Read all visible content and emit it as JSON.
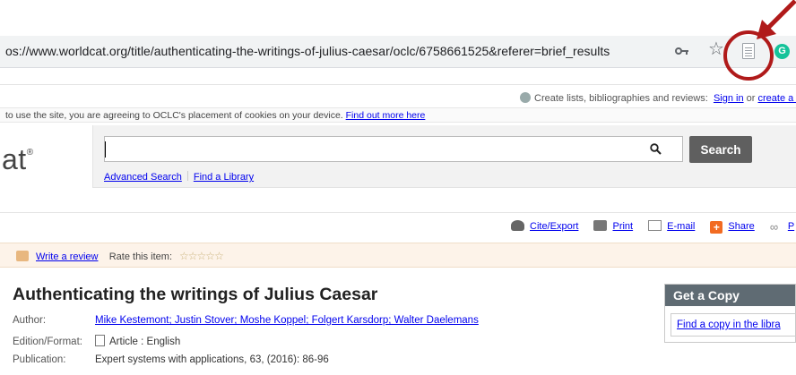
{
  "browser": {
    "url": "os://www.worldcat.org/title/authenticating-the-writings-of-julius-caesar/oclc/6758661525&referer=brief_results"
  },
  "header": {
    "create_lists_text": "Create lists, bibliographies and reviews:",
    "sign_in": "Sign in",
    "or": "or",
    "create_account": "create a f",
    "cookie_notice": "to use the site, you are agreeing to OCLC's placement of cookies on your device.",
    "cookie_link": "Find out more here"
  },
  "logo": {
    "text": "at",
    "mark": "®"
  },
  "search": {
    "value": "",
    "button_label": "Search",
    "advanced_link": "Advanced Search",
    "find_library_link": "Find a Library"
  },
  "toolbar": {
    "cite_export": "Cite/Export",
    "print": "Print",
    "email": "E-mail",
    "share": "Share",
    "permalink": "P"
  },
  "review": {
    "write_review": "Write a review",
    "rate_label": "Rate this item:",
    "stars": "☆☆☆☆☆"
  },
  "record": {
    "title": "Authenticating the writings of Julius Caesar",
    "author_label": "Author:",
    "authors": "Mike Kestemont; Justin Stover; Moshe Koppel; Folgert Karsdorp; Walter Daelemans",
    "edition_label": "Edition/Format:",
    "edition_value": "Article : English",
    "publication_label": "Publication:",
    "publication_value": "Expert systems with applications, 63, (2016): 86-96"
  },
  "get_copy": {
    "heading": "Get a Copy",
    "link": "Find a copy in the libra"
  },
  "colors": {
    "annotation_red": "#b01a1a",
    "search_button": "#5f5f5f",
    "link_blue": "#0000ee",
    "review_strip": "#fdf3e9"
  }
}
